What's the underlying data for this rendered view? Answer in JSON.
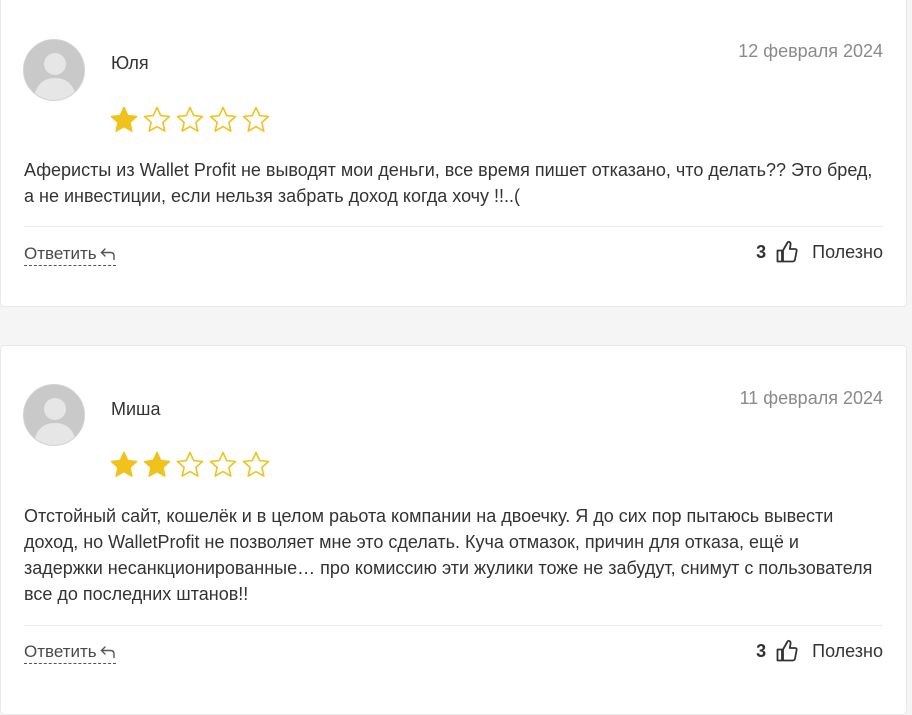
{
  "reviews": [
    {
      "author": "Юля",
      "date": "12 февраля 2024",
      "rating": 1,
      "max_rating": 5,
      "text": "Аферисты из Wallet Profit не выводят мои деньги, все время пишет отказано, что делать?? Это бред, а не инвестиции, если нельзя забрать доход когда хочу !!..(",
      "reply_label": "Ответить",
      "helpful_count": "3",
      "helpful_label": "Полезно"
    },
    {
      "author": "Миша",
      "date": "11 февраля 2024",
      "rating": 2,
      "max_rating": 5,
      "text": "Отстойный сайт, кошелёк и в целом раьота компании на двоечку. Я до сих пор пытаюсь вывести доход, но WalletProfit не позволяет мне это сделать. Куча отмазок, причин для отказа, ещё и задержки несанкционированные… про комиссию эти жулики тоже не забудут, снимут с пользователя все до последних штанов!!",
      "reply_label": "Ответить",
      "helpful_count": "3",
      "helpful_label": "Полезно"
    }
  ],
  "icons": {
    "avatar": "user-avatar-placeholder",
    "star_filled": "star-filled-icon",
    "star_empty": "star-outline-icon",
    "reply": "reply-arrow-icon",
    "thumb": "thumbs-up-icon"
  },
  "colors": {
    "star": "#f2c21c",
    "date": "#8a8a8a",
    "text": "#333333"
  }
}
